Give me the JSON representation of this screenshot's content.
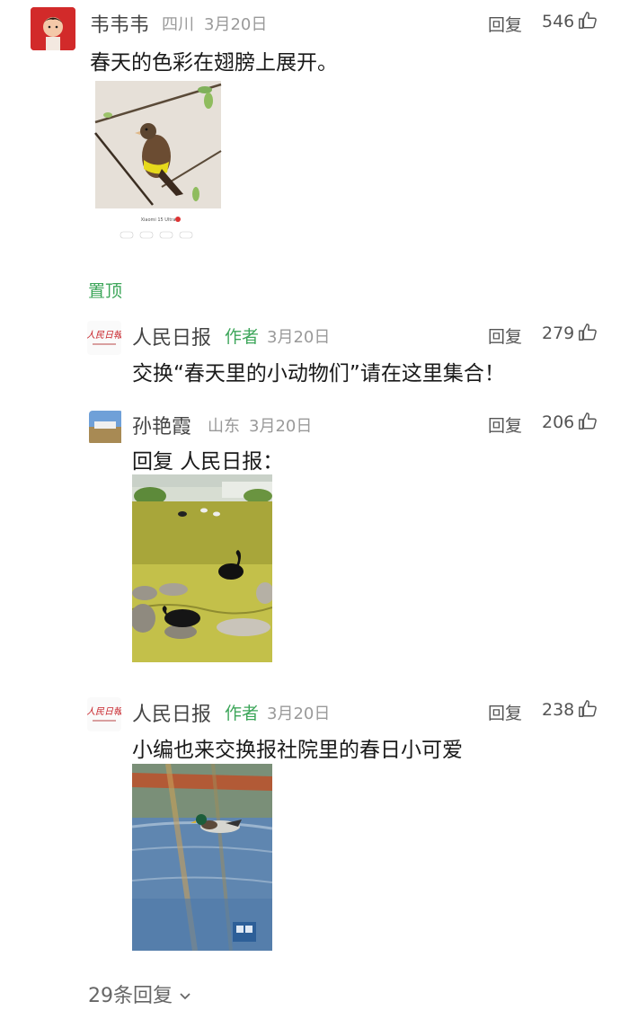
{
  "reply_label": "回复",
  "comments": [
    {
      "user": "韦韦韦",
      "location": "四川",
      "date": "3月20日",
      "likes": "546",
      "text": "春天的色彩在翅膀上展开。",
      "pin_label": "置顶",
      "watermark": "Xiaomi 15 Ultra"
    },
    {
      "user": "人民日报",
      "author_tag": "作者",
      "date": "3月20日",
      "likes": "279",
      "text": "交换“春天里的小动物们”请在这里集合！"
    },
    {
      "user": "孙艳霞",
      "location": "山东",
      "date": "3月20日",
      "likes": "206",
      "text": "回复 人民日报："
    },
    {
      "user": "人民日报",
      "author_tag": "作者",
      "date": "3月20日",
      "likes": "238",
      "text": "小编也来交换报社院里的春日小可爱"
    }
  ],
  "more_replies": "29条回复",
  "colors": {
    "accent_green": "#3da65a",
    "muted": "#9a9a9a"
  }
}
